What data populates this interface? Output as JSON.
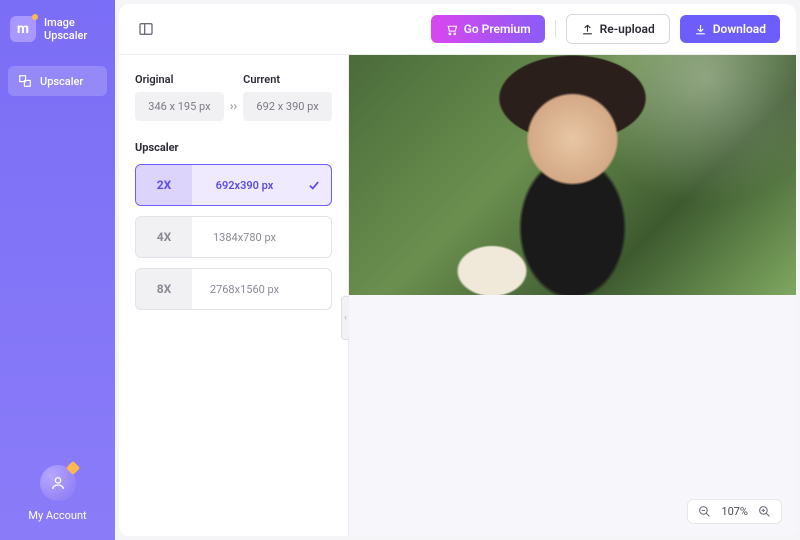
{
  "app": {
    "name": "Image\nUpscaler",
    "logo_letter": "m"
  },
  "sidebar": {
    "nav": [
      {
        "label": "Upscaler"
      }
    ],
    "account_label": "My Account"
  },
  "topbar": {
    "premium_label": "Go Premium",
    "reupload_label": "Re-upload",
    "download_label": "Download"
  },
  "panel": {
    "original_label": "Original",
    "current_label": "Current",
    "original_dim": "346 x 195 px",
    "current_dim": "692 x 390 px",
    "section_label": "Upscaler",
    "options": [
      {
        "mult": "2X",
        "dim": "692x390 px",
        "selected": true
      },
      {
        "mult": "4X",
        "dim": "1384x780 px",
        "selected": false
      },
      {
        "mult": "8X",
        "dim": "2768x1560 px",
        "selected": false
      }
    ]
  },
  "zoom": {
    "level": "107%"
  }
}
